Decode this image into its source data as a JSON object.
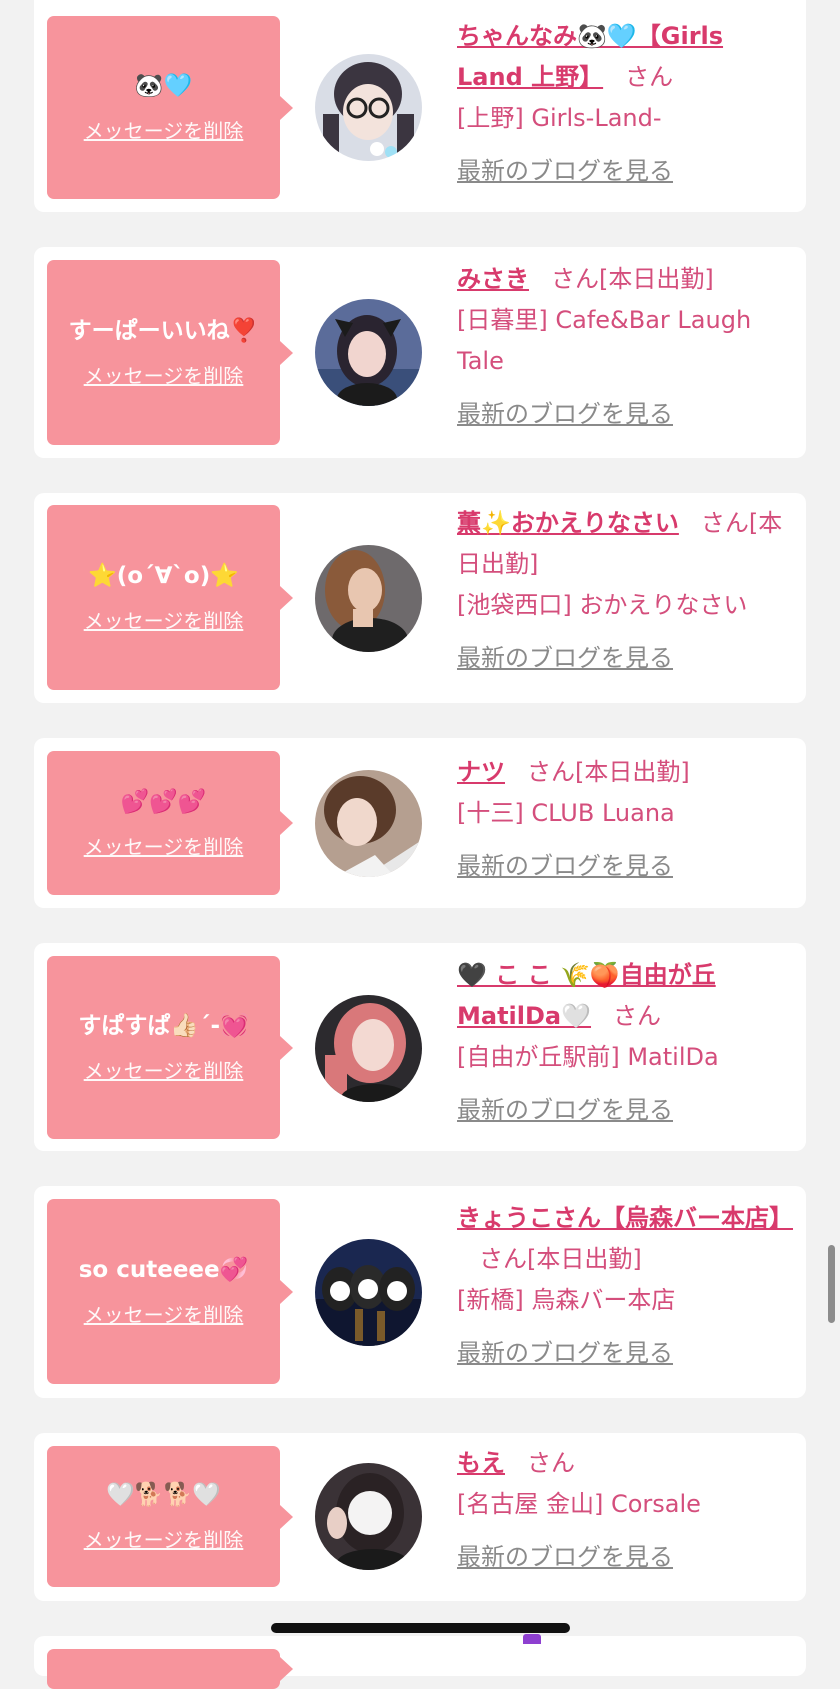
{
  "blog_link_label": "最新のブログを見る",
  "delete_label": "メッセージを削除",
  "san_label": "さん",
  "items": [
    {
      "message": "🐼🩵",
      "name": "ちゃんなみ🐼🩵【Girls Land 上野】",
      "on_duty": "",
      "shop": "[上野] Girls-Land-"
    },
    {
      "message": "すーぱーいいね❣️",
      "name": "みさき",
      "on_duty": "[本日出勤]",
      "shop": "[日暮里] Cafe&Bar Laugh Tale"
    },
    {
      "message": "⭐️(o´∀`o)⭐️",
      "name": "薫✨おかえりなさい",
      "on_duty": "[本日出勤]",
      "shop": "[池袋西口] おかえりなさい"
    },
    {
      "message": "💕💕💕",
      "name": "ナツ",
      "on_duty": "[本日出勤]",
      "shop": "[十三] CLUB Luana"
    },
    {
      "message": "すぱすぱ👍🏻´-💓",
      "name": "🖤 こ こ 🌾🍑自由が丘 MatilDa🤍",
      "on_duty": "",
      "shop": "[自由が丘駅前] MatilDa"
    },
    {
      "message": "so cuteeee💞",
      "name": "きょうこさん【烏森バー本店】",
      "on_duty": "[本日出勤]",
      "shop": "[新橋] 烏森バー本店"
    },
    {
      "message": "🤍🐕🐕🤍",
      "name": "もえ",
      "on_duty": "",
      "shop": "[名古屋 金山] Corsale"
    }
  ],
  "colors": {
    "page_bg": "#f2f2f2",
    "bubble_pink": "#f7949c",
    "name_pink": "#d83a6c",
    "link_gray": "#8a8a8a"
  }
}
